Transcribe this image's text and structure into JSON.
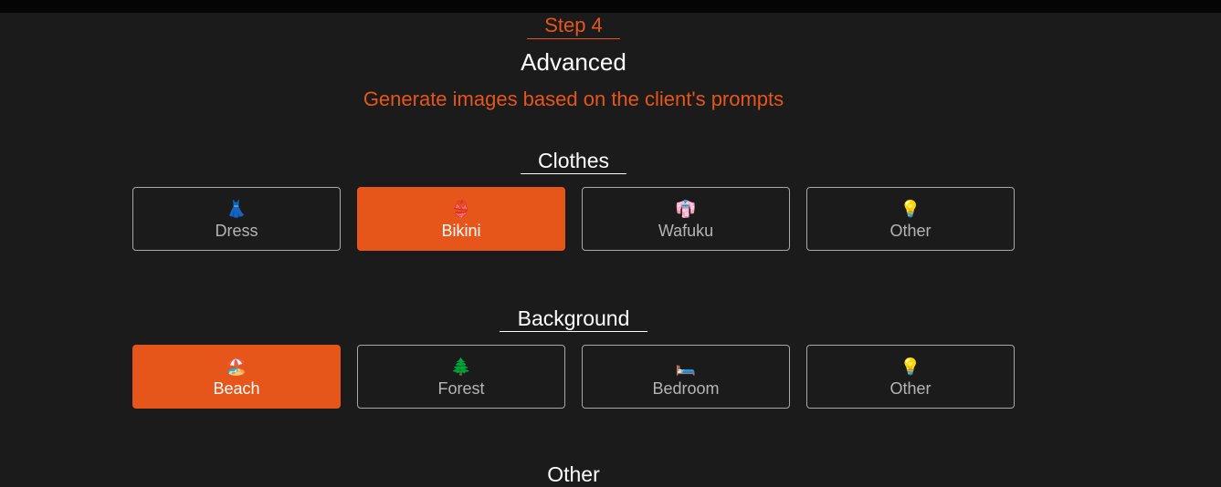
{
  "header": {
    "step": "Step 4",
    "title": "Advanced",
    "subtitle": "Generate images based on the client's prompts"
  },
  "sections": [
    {
      "heading": "Clothes",
      "options": [
        {
          "icon": "👗",
          "icon_name": "dress-icon",
          "label": "Dress",
          "selected": false
        },
        {
          "icon": "👙",
          "icon_name": "bikini-icon",
          "label": "Bikini",
          "selected": true
        },
        {
          "icon": "👘",
          "icon_name": "kimono-icon",
          "label": "Wafuku",
          "selected": false
        },
        {
          "icon": "💡",
          "icon_name": "lightbulb-icon",
          "label": "Other",
          "selected": false
        }
      ]
    },
    {
      "heading": "Background",
      "options": [
        {
          "icon": "🏖️",
          "icon_name": "beach-umbrella-icon",
          "label": "Beach",
          "selected": true
        },
        {
          "icon": "🌲",
          "icon_name": "evergreen-tree-icon",
          "label": "Forest",
          "selected": false
        },
        {
          "icon": "🛏️",
          "icon_name": "bed-icon",
          "label": "Bedroom",
          "selected": false
        },
        {
          "icon": "💡",
          "icon_name": "lightbulb-icon",
          "label": "Other",
          "selected": false
        }
      ]
    },
    {
      "heading": "Other"
    }
  ],
  "colors": {
    "accent": "#e6561a",
    "background": "#1b1b1b",
    "border": "#a8a8a8",
    "text_muted": "#b5b5b5"
  }
}
